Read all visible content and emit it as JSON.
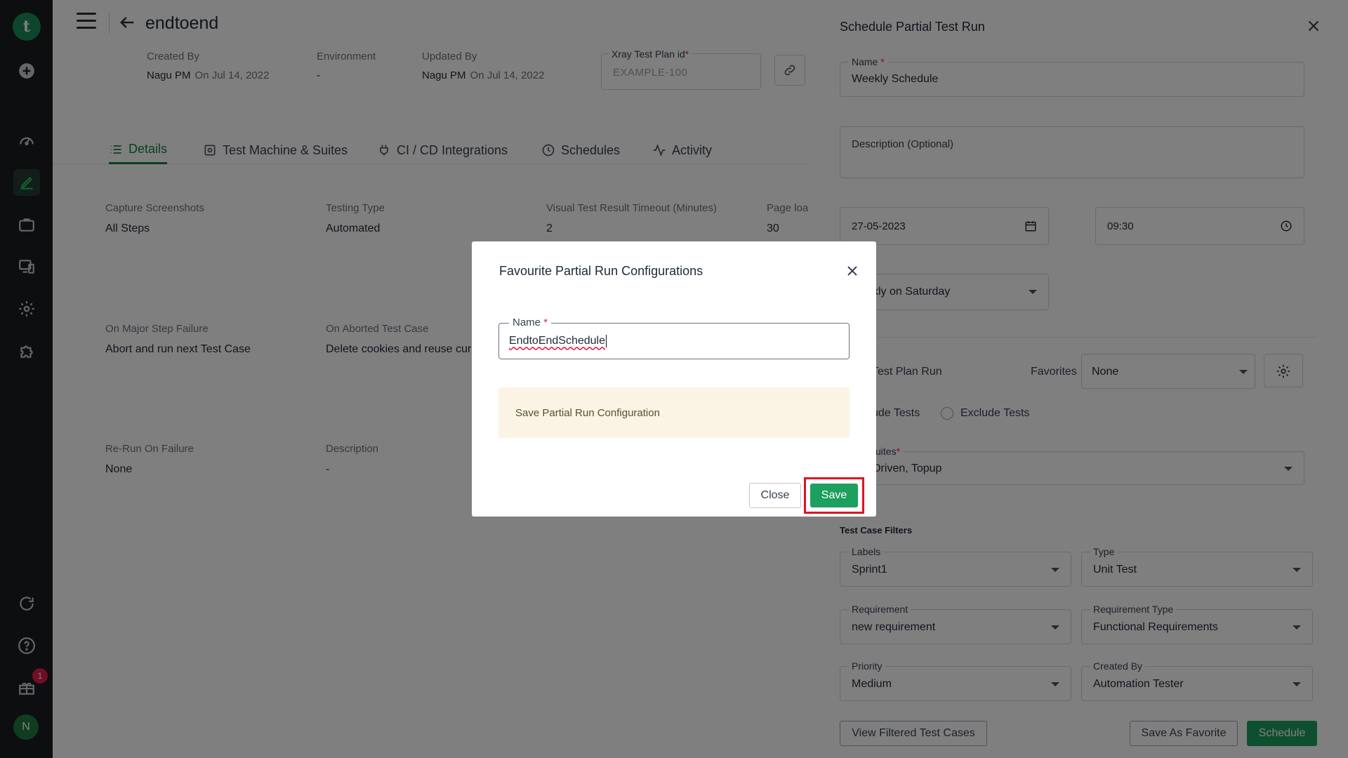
{
  "page": {
    "title": "endtoend",
    "meta": [
      {
        "label": "Created By",
        "user": "Nagu PM",
        "date": "On Jul 14, 2022"
      },
      {
        "label": "Environment",
        "value": "-"
      },
      {
        "label": "Updated By",
        "user": "Nagu PM",
        "date": "On Jul 14, 2022"
      }
    ],
    "xray": {
      "label": "Xray Test Plan id",
      "required": "*",
      "placeholder": "EXAMPLE-100"
    },
    "tabs": [
      {
        "label": "Details",
        "icon": "list-icon",
        "active": true
      },
      {
        "label": "Test Machine & Suites",
        "icon": "machine-icon"
      },
      {
        "label": "CI / CD Integrations",
        "icon": "plug-icon"
      },
      {
        "label": "Schedules",
        "icon": "clock-icon"
      },
      {
        "label": "Activity",
        "icon": "activity-icon"
      }
    ],
    "details": [
      {
        "label": "Capture Screenshots",
        "value": "All Steps"
      },
      {
        "label": "Testing Type",
        "value": "Automated"
      },
      {
        "label": "Visual Test Result Timeout (Minutes)",
        "value": "2"
      },
      {
        "label": "Page loa",
        "value": "30"
      },
      {
        "label": "On Major Step Failure",
        "value": "Abort and run next Test Case"
      },
      {
        "label": "On Aborted Test Case",
        "value": "Delete cookies and reuse curr"
      },
      {
        "label": "Re-Run On Failure",
        "value": "None"
      },
      {
        "label": "Description",
        "value": "-"
      }
    ]
  },
  "sidebar": {
    "logo": "t",
    "badge": "1",
    "avatar": "N"
  },
  "panel": {
    "title": "Schedule Partial Test Run",
    "name": {
      "label": "Name",
      "required": "*",
      "value": "Weekly Schedule"
    },
    "description": {
      "placeholder": "Description (Optional)"
    },
    "date": "27-05-2023",
    "time": "09:30",
    "recurrence": "kly on Saturday",
    "plan_run_label": "Test Plan Run",
    "favorites": {
      "label": "Favorites",
      "value": "None"
    },
    "include_label": "ude Tests",
    "exclude_label": "Exclude Tests",
    "suites": {
      "label": "uites",
      "required": "*",
      "value": "Driven, Topup"
    },
    "filters_title": "Test Case Filters",
    "filters": [
      {
        "label": "Labels",
        "value": "Sprint1"
      },
      {
        "label": "Type",
        "value": "Unit Test"
      },
      {
        "label": "Requirement",
        "value": "new requirement"
      },
      {
        "label": "Requirement Type",
        "value": "Functional Requirements"
      },
      {
        "label": "Priority",
        "value": "Medium"
      },
      {
        "label": "Created By",
        "value": "Automation Tester"
      }
    ],
    "buttons": {
      "view_filtered": "View Filtered Test Cases",
      "save_favorite": "Save As Favorite",
      "schedule": "Schedule"
    }
  },
  "modal": {
    "title": "Favourite Partial Run Configurations",
    "name": {
      "label": "Name",
      "required": "*",
      "value": "EndtoEndSchedule"
    },
    "notice": "Save Partial Run Configuration",
    "close_label": "Close",
    "save_label": "Save"
  },
  "colors": {
    "accent": "#1d9f5f",
    "highlight": "#e1131f",
    "sidebar": "#1a1d21"
  }
}
